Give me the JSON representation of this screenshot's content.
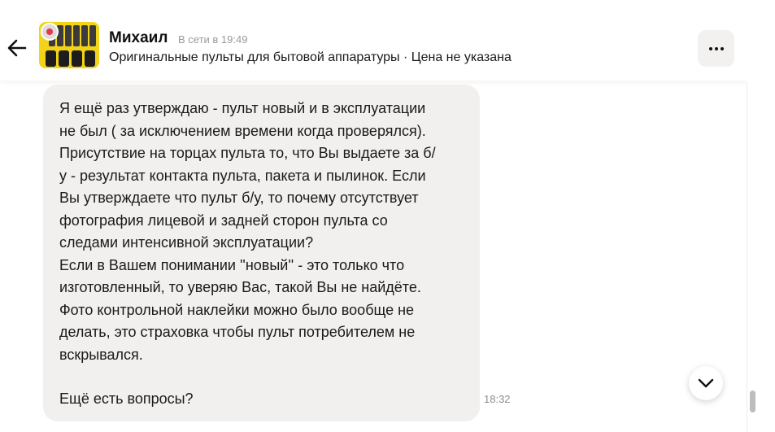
{
  "header": {
    "back_icon": "arrow-left-icon",
    "contact_name": "Михаил",
    "online_status": "В сети в 19:49",
    "ad_title": "Оригинальные пульты для бытовой аппаратуры · Цена не указана",
    "more_icon": "more-horizontal-icon"
  },
  "message": {
    "paragraph_1": "Я ещё раз утверждаю - пульт новый и в эксплуатации\nне был ( за исключением времени когда проверялся).\nПрисутствие на торцах пульта то, что Вы выдаете за б/\nу - результат контакта пульта, пакета и пылинок. Если\nВы утверждаете что пульт б/у, то почему отсутствует\nфотография лицевой и задней сторон пульта со\nследами интенсивной эксплуатации?\nЕсли в Вашем понимании ''новый'' - это только что\nизготовленный, то уверяю Вас, такой Вы не найдёте.\nФото контрольной наклейки можно было вообще не\nделать, это страховка чтобы пульт потребителем не\nвскрывался.",
    "paragraph_2": "Ещё есть вопросы?",
    "time": "18:32"
  },
  "controls": {
    "scroll_down_icon": "chevron-down-icon"
  },
  "colors": {
    "bubble_bg": "#f1f0ee",
    "avatar_bg": "#f3d21a",
    "secondary_text": "#9a9a9a"
  }
}
